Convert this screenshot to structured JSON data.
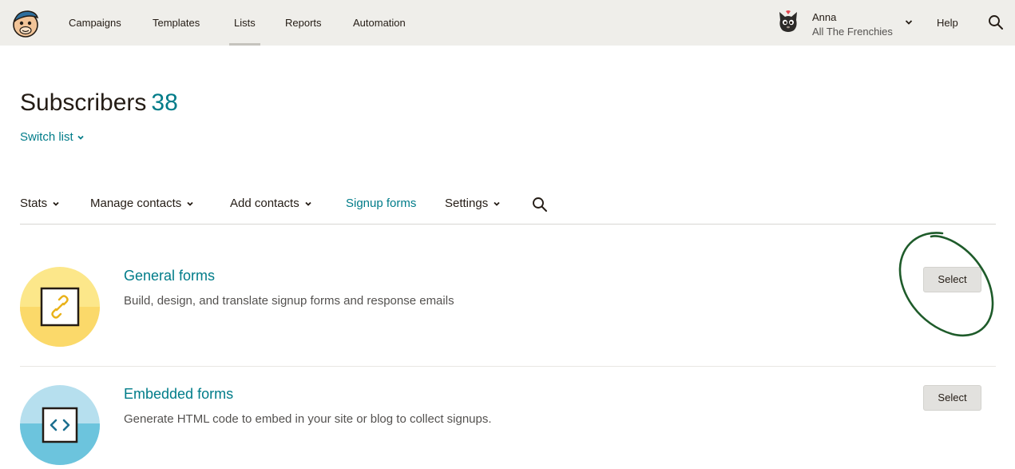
{
  "topnav": {
    "items": [
      {
        "label": "Campaigns"
      },
      {
        "label": "Templates"
      },
      {
        "label": "Lists"
      },
      {
        "label": "Reports"
      },
      {
        "label": "Automation"
      }
    ],
    "active": "Lists",
    "account": {
      "name": "Anna",
      "org": "All The Frenchies"
    },
    "help_label": "Help",
    "icons": {
      "logo": "freddie-logo",
      "search": "search-icon",
      "avatar": "cat-avatar"
    }
  },
  "header": {
    "title": "Subscribers",
    "count": "38",
    "switch_list_label": "Switch list"
  },
  "subnav": {
    "items": [
      {
        "label": "Stats",
        "has_dropdown": true
      },
      {
        "label": "Manage contacts",
        "has_dropdown": true
      },
      {
        "label": "Add contacts",
        "has_dropdown": true
      },
      {
        "label": "Signup forms",
        "has_dropdown": false
      },
      {
        "label": "Settings",
        "has_dropdown": true
      }
    ],
    "active": "Signup forms"
  },
  "forms": [
    {
      "title": "General forms",
      "description": "Build, design, and translate signup forms and response emails",
      "button_label": "Select",
      "icon": "link-icon",
      "icon_color": "#ffe01b"
    },
    {
      "title": "Embedded forms",
      "description": "Generate HTML code to embed in your site or blog to collect signups.",
      "button_label": "Select",
      "icon": "code-icon",
      "icon_color": "#74c6e0"
    }
  ],
  "colors": {
    "topbar_bg": "#efeeea",
    "accent": "#007c89",
    "annotation": "#1e5b2a"
  }
}
